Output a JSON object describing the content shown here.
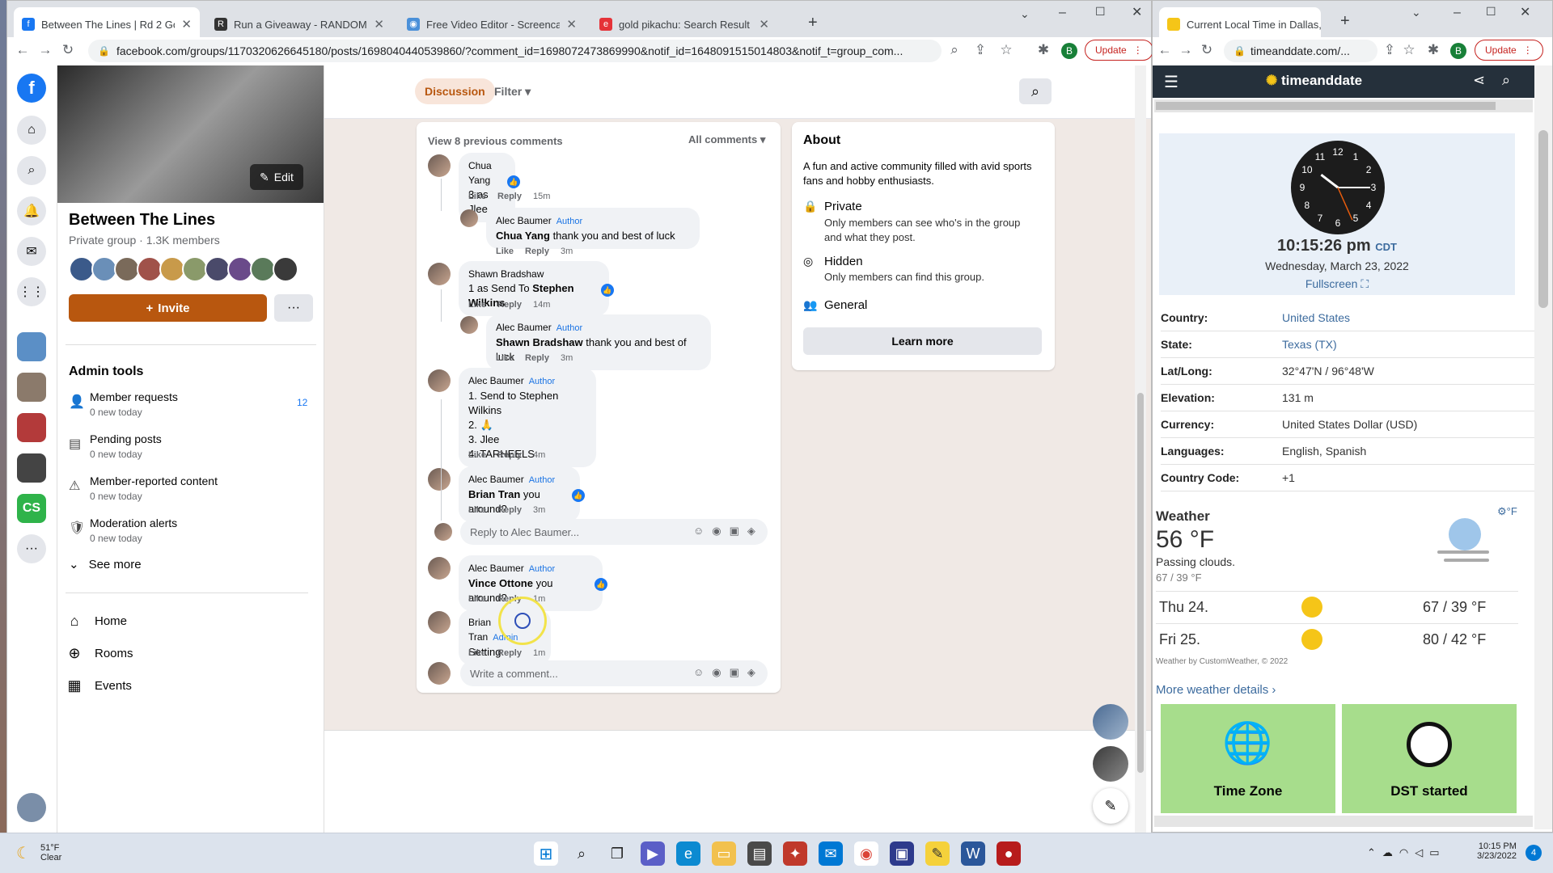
{
  "browser1": {
    "tabs": [
      {
        "title": "Between The Lines | Rd 2 Gorma",
        "color": "#1877f2",
        "fav": "f"
      },
      {
        "title": "Run a Giveaway - RANDOM.ORG",
        "color": "#333",
        "fav": "R"
      },
      {
        "title": "Free Video Editor - Screencast-O",
        "color": "#4a90d9",
        "fav": "◉"
      },
      {
        "title": "gold pikachu: Search Result | eBa",
        "color": "#e53238",
        "fav": "e"
      }
    ],
    "url": "facebook.com/groups/1170320626645180/posts/1698040440539860/?comment_id=1698072473869990&notif_id=1648091515014803&notif_t=group_com...",
    "update_label": "Update",
    "profile_initial": "B"
  },
  "group": {
    "name": "Between The Lines",
    "privacy_members": "Private group · 1.3K members",
    "edit_label": "Edit",
    "invite_label": "Invite",
    "more_label": "···",
    "admin_tools_title": "Admin tools",
    "admin_items": [
      {
        "label": "Member requests",
        "sub": "0 new today",
        "badge": "12",
        "icon": "person-add-icon"
      },
      {
        "label": "Pending posts",
        "sub": "0 new today",
        "badge": "",
        "icon": "pending-posts-icon"
      },
      {
        "label": "Member-reported content",
        "sub": "0 new today",
        "badge": "",
        "icon": "report-icon"
      },
      {
        "label": "Moderation alerts",
        "sub": "0 new today",
        "badge": "",
        "icon": "alert-icon"
      }
    ],
    "see_more": "See more",
    "nav": [
      {
        "label": "Home",
        "icon": "home-icon"
      },
      {
        "label": "Rooms",
        "icon": "rooms-icon"
      },
      {
        "label": "Events",
        "icon": "events-icon"
      }
    ]
  },
  "subnav": {
    "discussion": "Discussion",
    "filter": "Filter"
  },
  "comments_header": {
    "view_prev": "View 8 previous comments",
    "sort": "All comments"
  },
  "comments": [
    {
      "name": "Chua Yang",
      "tag": "",
      "text": "3 as Jlee",
      "time": "15m",
      "reply": false,
      "like": "Like",
      "replyl": "Reply"
    },
    {
      "name": "Alec Baumer",
      "tag": "Author",
      "mention": "Chua Yang",
      "text": " thank you and best of luck",
      "time": "3m",
      "reply": true,
      "like": "Like",
      "replyl": "Reply"
    },
    {
      "name": "Shawn Bradshaw",
      "tag": "",
      "text": "1 as Send To ",
      "mention2": "Stephen Wilkins",
      "time": "14m",
      "reply": false,
      "like": "Like",
      "replyl": "Reply"
    },
    {
      "name": "Alec Baumer",
      "tag": "Author",
      "mention": "Shawn Bradshaw",
      "text": " thank you and best of luck",
      "time": "3m",
      "reply": true,
      "like": "Like",
      "replyl": "Reply"
    },
    {
      "name": "Alec Baumer",
      "tag": "Author",
      "lines": [
        "1. Send to Stephen Wilkins",
        "2. 🙏",
        "3. Jlee",
        "4. TARHEELS"
      ],
      "time": "4m",
      "reply": false,
      "like": "Like",
      "replyl": "Reply"
    },
    {
      "name": "Alec Baumer",
      "tag": "Author",
      "mention": "Brian Tran",
      "text": " you around?",
      "time": "3m",
      "reply": false,
      "like": "Like",
      "replyl": "Reply"
    },
    {
      "name": "Alec Baumer",
      "tag": "Author",
      "mention": "Vince Ottone",
      "text": " you around?",
      "time": "1m",
      "reply": false,
      "like": "Like",
      "replyl": "Reply"
    },
    {
      "name": "Brian Tran",
      "tag": "Admin",
      "text": "Setting",
      "time": "1m",
      "reply": false,
      "like": "Like",
      "replyl": "Reply"
    }
  ],
  "reply_placeholder": "Reply to Alec Baumer...",
  "comment_placeholder": "Write a comment...",
  "about": {
    "title": "About",
    "desc": "A fun and active community filled with avid sports fans and hobby enthusiasts.",
    "private_title": "Private",
    "private_desc": "Only members can see who's in the group and what they post.",
    "hidden_title": "Hidden",
    "hidden_desc": "Only members can find this group.",
    "general": "General",
    "learn_more": "Learn more"
  },
  "browser2": {
    "tab": "Current Local Time in Dallas,",
    "url": "timeanddate.com/...",
    "update_label": "Update",
    "profile_initial": "B",
    "logo": "timeanddate",
    "time": "10:15:26 pm",
    "tz": "CDT",
    "date": "Wednesday, March 23, 2022",
    "fullscreen": "Fullscreen",
    "rows": [
      {
        "k": "Country:",
        "v": "United States",
        "link": true
      },
      {
        "k": "State:",
        "v": "Texas (TX)",
        "link": true
      },
      {
        "k": "Lat/Long:",
        "v": "32°47'N / 96°48'W",
        "link": false
      },
      {
        "k": "Elevation:",
        "v": "131 m",
        "link": false
      },
      {
        "k": "Currency:",
        "v": "United States Dollar (USD)",
        "link": false
      },
      {
        "k": "Languages:",
        "v": "English, Spanish",
        "link": false
      },
      {
        "k": "Country Code:",
        "v": "+1",
        "link": false
      }
    ],
    "weather_title": "Weather",
    "unit": "°F",
    "temp": "56 °F",
    "cond": "Passing clouds.",
    "range": "67 / 39 °F",
    "forecast": [
      {
        "day": "Thu 24.",
        "temps": "67 / 39 °F"
      },
      {
        "day": "Fri 25.",
        "temps": "80 / 42 °F"
      }
    ],
    "credit": "Weather by CustomWeather, © 2022",
    "more_weather": "More weather details",
    "tiles": [
      "Time Zone",
      "DST started"
    ]
  },
  "clock_numbers": [
    "12",
    "1",
    "2",
    "3",
    "4",
    "5",
    "6",
    "7",
    "8",
    "9",
    "10",
    "11"
  ],
  "taskbar": {
    "weather_temp": "51°F",
    "weather_cond": "Clear",
    "time": "10:15 PM",
    "date": "3/23/2022",
    "notif": "4"
  }
}
